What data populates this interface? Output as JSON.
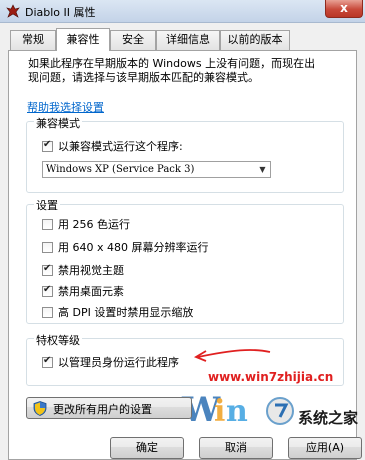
{
  "window": {
    "title": "Diablo II 属性",
    "close_symbol": "x"
  },
  "tabs": [
    {
      "label": "常规",
      "active": false
    },
    {
      "label": "兼容性",
      "active": true
    },
    {
      "label": "安全",
      "active": false
    },
    {
      "label": "详细信息",
      "active": false
    },
    {
      "label": "以前的版本",
      "active": false
    }
  ],
  "intro": {
    "line1": "如果此程序在早期版本的 Windows 上没有问题，而现在出",
    "line2": "现问题，请选择与该早期版本匹配的兼容模式。"
  },
  "help_link": "帮助我选择设置",
  "compat_mode": {
    "group_label": "兼容模式",
    "checkbox_label": "以兼容模式运行这个程序:",
    "checked": true,
    "selected_os": "Windows XP (Service Pack 3)"
  },
  "settings": {
    "group_label": "设置",
    "items": [
      {
        "label": "用 256 色运行",
        "checked": false
      },
      {
        "label": "用 640 x 480 屏幕分辨率运行",
        "checked": false
      },
      {
        "label": "禁用视觉主题",
        "checked": true
      },
      {
        "label": "禁用桌面元素",
        "checked": true
      },
      {
        "label": "高 DPI 设置时禁用显示缩放",
        "checked": false
      }
    ]
  },
  "privilege": {
    "group_label": "特权等级",
    "checkbox_label": "以管理员身份运行此程序",
    "checked": true
  },
  "all_users_button": "更改所有用户的设置",
  "bottom_buttons": {
    "ok": "确定",
    "cancel": "取消",
    "apply": "应用(A)"
  },
  "watermark": {
    "url": "www.win7zhijia.cn",
    "brand": "系统之家"
  },
  "colors": {
    "link": "#0066cc",
    "watermark_red": "#e02020",
    "close_button": "#c8493a"
  }
}
